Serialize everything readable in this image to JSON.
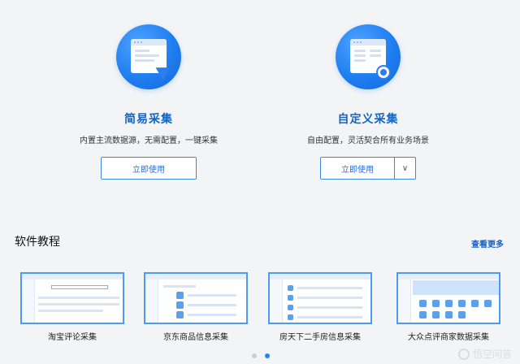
{
  "modes": [
    {
      "title": "简易采集",
      "desc": "内置主流数据源，无需配置，一键采集",
      "button": "立即使用",
      "icon": "paper-plane-icon"
    },
    {
      "title": "自定义采集",
      "desc": "自由配置，灵活契合所有业务场景",
      "button": "立即使用",
      "dropdown": "∨",
      "icon": "gear-icon"
    }
  ],
  "tutorials": {
    "title": "软件教程",
    "more": "查看更多",
    "items": [
      {
        "label": "淘宝评论采集"
      },
      {
        "label": "京东商品信息采集"
      },
      {
        "label": "房天下二手房信息采集"
      },
      {
        "label": "大众点评商家数据采集"
      }
    ]
  },
  "pager": {
    "total": 2,
    "active": 2
  },
  "watermark": "悟空问答",
  "colors": {
    "accent": "#1565c0",
    "border": "#3d86e0",
    "link": "#1a5fc4"
  }
}
